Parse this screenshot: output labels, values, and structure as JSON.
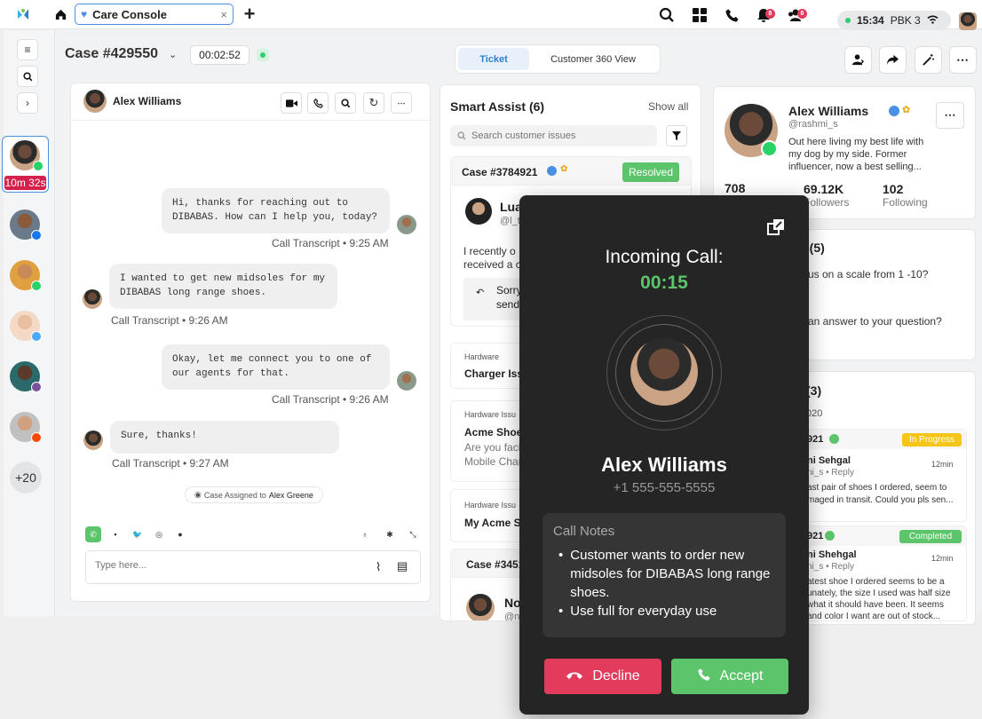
{
  "topbar": {
    "tab_label": "Care Console",
    "tab_close": "×",
    "add_tab": "+",
    "notif_badge_1": "8",
    "notif_badge_2": "8",
    "time": "15:34",
    "network": "PBK 3"
  },
  "rail": {
    "active_timer": "10m 32s",
    "more_count": "+20"
  },
  "header": {
    "case_title": "Case #429550",
    "timer": "00:02:52",
    "tabs": [
      "Ticket",
      "Customer 360 View"
    ]
  },
  "conversation": {
    "contact_name": "Alex Williams",
    "messages": [
      {
        "text": "Hi, thanks for reaching out to DIBABAS. How can I help you, today?",
        "meta": "Call Transcript • 9:25 AM",
        "side": "agent"
      },
      {
        "text": "I wanted to get new midsoles for my DIBABAS long range shoes.",
        "meta": "Call Transcript • 9:26 AM",
        "side": "customer"
      },
      {
        "text": "Okay, let me connect you to one of our agents for that.",
        "meta": "Call Transcript • 9:26 AM",
        "side": "agent"
      },
      {
        "text": "Sure, thanks!",
        "meta": "Call Transcript • 9:27 AM",
        "side": "customer"
      }
    ],
    "assigned_note": "Case Assigned to",
    "assigned_to": "Alex Greene",
    "compose_placeholder": "Type here..."
  },
  "smart_assist": {
    "title": "Smart Assist (6)",
    "show_all": "Show all",
    "search_placeholder": "Search customer issues",
    "case1": {
      "id": "Case #3784921",
      "status": "Resolved",
      "user": "Lua",
      "handle": "@l_t",
      "preview": "I recently o",
      "preview2": "received a c",
      "reply": "Sorry",
      "reply2": "send"
    },
    "card2": {
      "tag": "Hardware",
      "title": "Charger Iss"
    },
    "card3": {
      "tag": "Hardware Issu",
      "title": "Acme Shoe",
      "preview": "Are you faci",
      "preview2": "Mobile Char"
    },
    "card4": {
      "tag": "Hardware Issu",
      "title": "My Acme S2"
    },
    "case2": {
      "id": "Case #3451",
      "user": "Nol",
      "handle": "@n_"
    }
  },
  "profile": {
    "name": "Alex Williams",
    "handle": "@rashmi_s",
    "bio": "Out here living my best life with my dog by my side. Former influencer, now a best selling...",
    "posts": "708",
    "followers": "69.12K",
    "followers_label": "Followers",
    "following": "102",
    "following_label": "Following"
  },
  "survey": {
    "title": "s (5)",
    "q1": "us on a scale from 1 -10?",
    "q2": "an answer to your question?"
  },
  "related": {
    "title": "(3)",
    "sub": "020",
    "item1": {
      "id": "921",
      "status": "In Progress",
      "user": "ni Sehgal",
      "handle": "ni_s • Reply",
      "time": "12min",
      "text1": "ast pair of shoes I ordered, seem to",
      "text2": "maged in transit. Could you pls sen..."
    },
    "item2": {
      "id": "921",
      "status": "Completed",
      "user": "ni Shehgal",
      "handle": "ni_s • Reply",
      "time": "12min",
      "text1": "atest shoe I ordered seems to be a",
      "text2": "unately, the size I used was half size",
      "text3": "what it should have been. It seems",
      "text4": "and color I want are out of stock..."
    }
  },
  "call": {
    "title": "Incoming Call:",
    "timer": "00:15",
    "caller": "Alex Williams",
    "phone": "+1 555-555-5555",
    "notes_title": "Call Notes",
    "notes": [
      "Customer wants to order new midsoles for DIBABAS long range shoes.",
      "Use full for everyday use"
    ],
    "decline": "Decline",
    "accept": "Accept"
  },
  "colors": {
    "accent": "#4a90e2",
    "green": "#5cc46a",
    "red": "#e23b5b",
    "modal": "#252526"
  }
}
